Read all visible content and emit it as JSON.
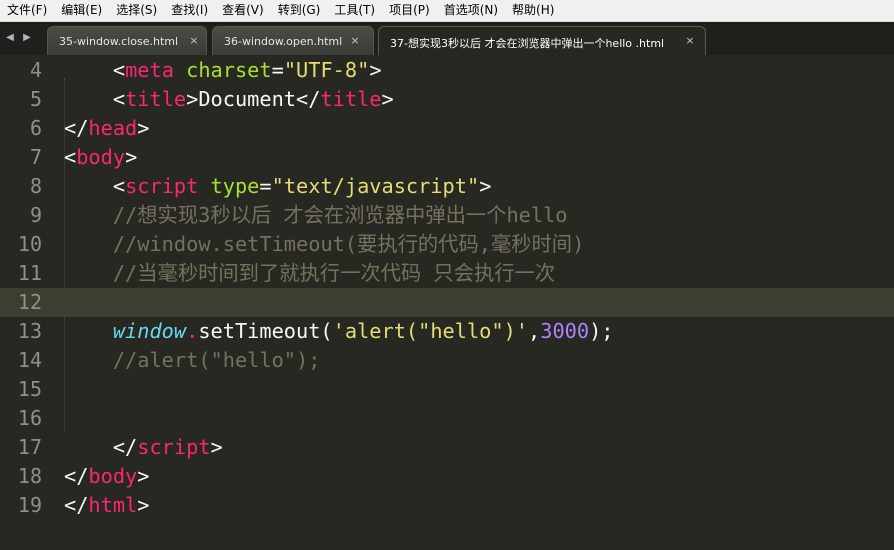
{
  "menu": [
    {
      "label": "文件(F)"
    },
    {
      "label": "编辑(E)"
    },
    {
      "label": "选择(S)"
    },
    {
      "label": "查找(I)"
    },
    {
      "label": "查看(V)"
    },
    {
      "label": "转到(G)"
    },
    {
      "label": "工具(T)"
    },
    {
      "label": "项目(P)"
    },
    {
      "label": "首选项(N)"
    },
    {
      "label": "帮助(H)"
    }
  ],
  "nav": {
    "prev_icon": "◀",
    "next_icon": "▶"
  },
  "tabs": [
    {
      "label": "35-window.close.html",
      "close": "×",
      "active": false
    },
    {
      "label": "36-window.open.html",
      "close": "×",
      "active": false
    },
    {
      "label": "37-想实现3秒以后 才会在浏览器中弹出一个hello .html",
      "close": "×",
      "active": true
    }
  ],
  "editor": {
    "current_line": 12,
    "lines": [
      {
        "num": "4",
        "tokens": [
          {
            "t": "    <",
            "c": "plain"
          },
          {
            "t": "meta",
            "c": "tag"
          },
          {
            "t": " ",
            "c": "plain"
          },
          {
            "t": "charset",
            "c": "attr"
          },
          {
            "t": "=",
            "c": "plain"
          },
          {
            "t": "\"UTF-8\"",
            "c": "string"
          },
          {
            "t": ">",
            "c": "plain"
          }
        ]
      },
      {
        "num": "5",
        "tokens": [
          {
            "t": "    <",
            "c": "plain"
          },
          {
            "t": "title",
            "c": "tag"
          },
          {
            "t": ">Document</",
            "c": "plain"
          },
          {
            "t": "title",
            "c": "tag"
          },
          {
            "t": ">",
            "c": "plain"
          }
        ]
      },
      {
        "num": "6",
        "tokens": [
          {
            "t": "</",
            "c": "plain"
          },
          {
            "t": "head",
            "c": "tag"
          },
          {
            "t": ">",
            "c": "plain"
          }
        ]
      },
      {
        "num": "7",
        "tokens": [
          {
            "t": "<",
            "c": "plain"
          },
          {
            "t": "body",
            "c": "tag"
          },
          {
            "t": ">",
            "c": "plain"
          }
        ]
      },
      {
        "num": "8",
        "tokens": [
          {
            "t": "    <",
            "c": "plain"
          },
          {
            "t": "script",
            "c": "tag"
          },
          {
            "t": " ",
            "c": "plain"
          },
          {
            "t": "type",
            "c": "attr"
          },
          {
            "t": "=",
            "c": "plain"
          },
          {
            "t": "\"text/javascript\"",
            "c": "string"
          },
          {
            "t": ">",
            "c": "plain"
          }
        ]
      },
      {
        "num": "9",
        "tokens": [
          {
            "t": "    //想实现3秒以后 才会在浏览器中弹出一个hello",
            "c": "comment"
          }
        ]
      },
      {
        "num": "10",
        "tokens": [
          {
            "t": "    //window.setTimeout(要执行的代码,毫秒时间)",
            "c": "comment"
          }
        ]
      },
      {
        "num": "11",
        "tokens": [
          {
            "t": "    //当毫秒时间到了就执行一次代码 只会执行一次",
            "c": "comment"
          }
        ]
      },
      {
        "num": "12",
        "tokens": []
      },
      {
        "num": "13",
        "tokens": [
          {
            "t": "    ",
            "c": "plain"
          },
          {
            "t": "window",
            "c": "builtin"
          },
          {
            "t": ".",
            "c": "keyword"
          },
          {
            "t": "setTimeout(",
            "c": "plain"
          },
          {
            "t": "'alert(\"hello\")'",
            "c": "string"
          },
          {
            "t": ",",
            "c": "plain"
          },
          {
            "t": "3000",
            "c": "number"
          },
          {
            "t": ");",
            "c": "plain"
          }
        ]
      },
      {
        "num": "14",
        "tokens": [
          {
            "t": "    //alert(\"hello\");",
            "c": "comment"
          }
        ]
      },
      {
        "num": "15",
        "tokens": []
      },
      {
        "num": "16",
        "tokens": []
      },
      {
        "num": "17",
        "tokens": [
          {
            "t": "    </",
            "c": "plain"
          },
          {
            "t": "script",
            "c": "tag"
          },
          {
            "t": ">",
            "c": "plain"
          }
        ]
      },
      {
        "num": "18",
        "tokens": [
          {
            "t": "</",
            "c": "plain"
          },
          {
            "t": "body",
            "c": "tag"
          },
          {
            "t": ">",
            "c": "plain"
          }
        ]
      },
      {
        "num": "19",
        "tokens": [
          {
            "t": "</",
            "c": "plain"
          },
          {
            "t": "html",
            "c": "tag"
          },
          {
            "t": ">",
            "c": "plain"
          }
        ]
      }
    ]
  }
}
